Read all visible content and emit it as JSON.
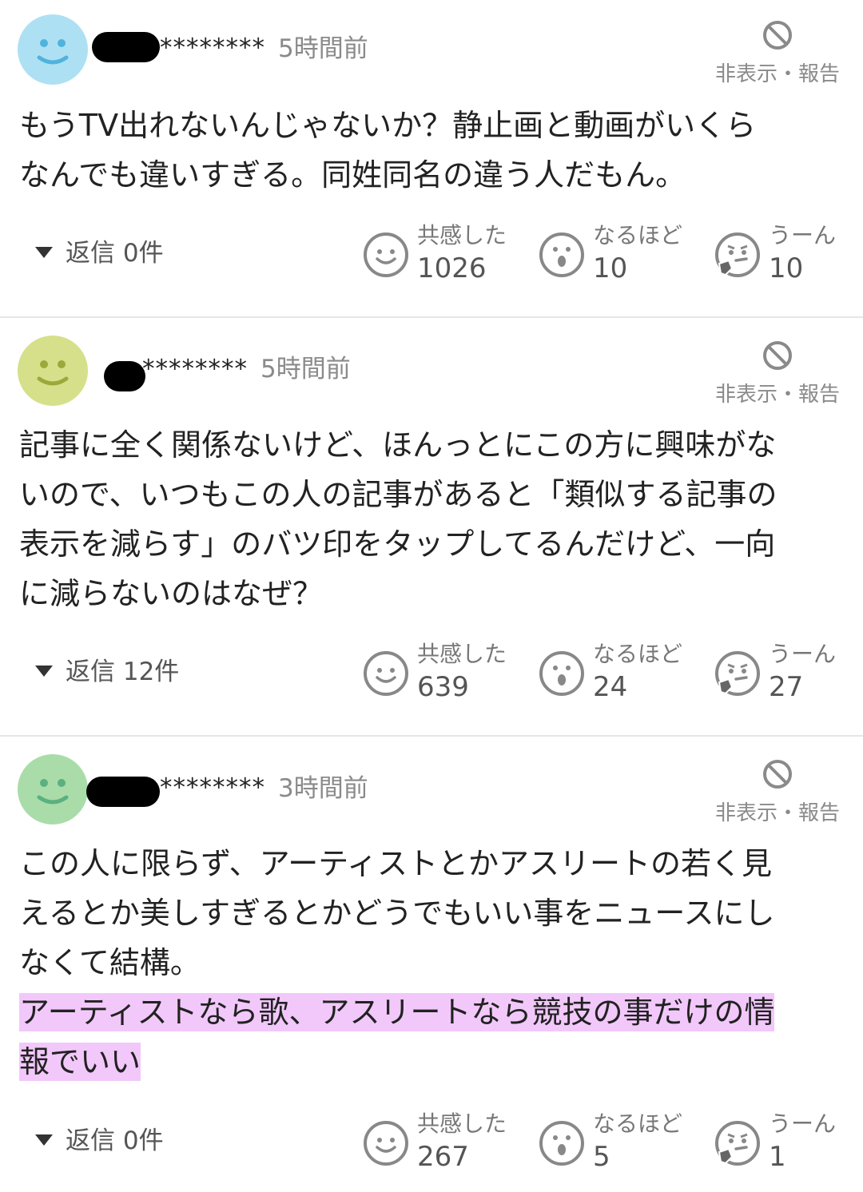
{
  "comments": [
    {
      "username": "********",
      "time": "5時間前",
      "avatar_color": "#aee0f3",
      "avatar_stroke": "#4fb3dc",
      "hide_report": "非表示・報告",
      "body_lines": [
        "もうTV出れないんじゃないか？静止画と動画がいくら",
        "なんでも違いすぎる。同姓同名の違う人だもん。"
      ],
      "highlight_lines": [],
      "replies": "返信 0件",
      "reactions": [
        {
          "label": "共感した",
          "count": "1026",
          "icon": "smile-icon"
        },
        {
          "label": "なるほど",
          "count": "10",
          "icon": "surprised-icon"
        },
        {
          "label": "うーん",
          "count": "10",
          "icon": "thinking-icon"
        }
      ]
    },
    {
      "username": "********",
      "time": "5時間前",
      "avatar_color": "#d6e08a",
      "avatar_stroke": "#9aa93a",
      "hide_report": "非表示・報告",
      "body_lines": [
        "記事に全く関係ないけど、ほんっとにこの方に興味がな",
        "いので、いつもこの人の記事があると「類似する記事の",
        "表示を減らす」のバツ印をタップしてるんだけど、一向",
        "に減らないのはなぜ？"
      ],
      "highlight_lines": [],
      "replies": "返信 12件",
      "reactions": [
        {
          "label": "共感した",
          "count": "639",
          "icon": "smile-icon"
        },
        {
          "label": "なるほど",
          "count": "24",
          "icon": "surprised-icon"
        },
        {
          "label": "うーん",
          "count": "27",
          "icon": "thinking-icon"
        }
      ]
    },
    {
      "username": "********",
      "time": "3時間前",
      "avatar_color": "#a9dca9",
      "avatar_stroke": "#5bb07f",
      "hide_report": "非表示・報告",
      "body_lines": [
        "この人に限らず、アーティストとかアスリートの若く見",
        "えるとか美しすぎるとかどうでもいい事をニュースにし",
        "なくて結構。"
      ],
      "highlight_lines": [
        "アーティストなら歌、アスリートなら競技の事だけの情",
        "報でいい"
      ],
      "replies": "返信 0件",
      "reactions": [
        {
          "label": "共感した",
          "count": "267",
          "icon": "smile-icon"
        },
        {
          "label": "なるほど",
          "count": "5",
          "icon": "surprised-icon"
        },
        {
          "label": "うーん",
          "count": "1",
          "icon": "thinking-icon"
        }
      ]
    }
  ]
}
